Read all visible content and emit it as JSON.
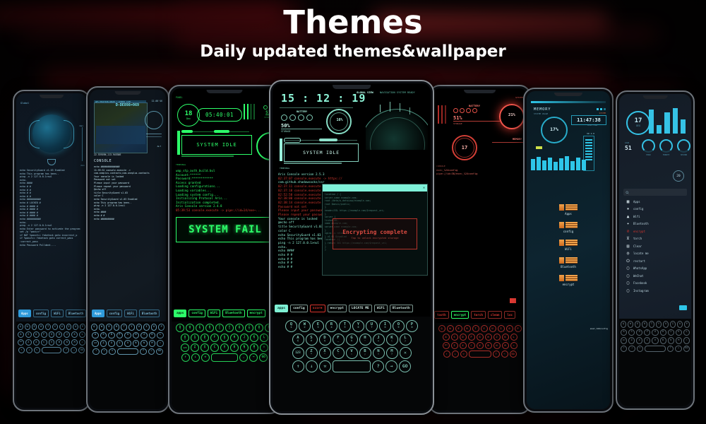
{
  "header": {
    "title": "Themes",
    "subtitle": "Daily updated themes&wallpaper"
  },
  "colors": {
    "accent_teal": "#7ff5d8",
    "accent_green": "#2dff6a",
    "accent_red": "#ff3a36",
    "accent_blue": "#3aa8e0",
    "accent_cyan": "#2ec6e8",
    "bezel": "#6d737a",
    "background": "#050203"
  },
  "phones": [
    {
      "id": "phone-blue-globe",
      "theme": "blue",
      "status_label": "Global",
      "meter_label": "Signal",
      "meter_min": "min",
      "meter_max": "max",
      "console_lines": [
        "echo SecurityGuard v1.03 Enabled",
        "echo This program has been..",
        "ping -n 2 127.0.0.1>nul",
        "echo.",
        "echo  ####",
        "echo #    #",
        "echo #    #",
        "echo #    #",
        "echo #    #",
        "echo ##########",
        "echo # LOCKED #",
        "echo # #### #",
        "echo # #### #",
        "echo # #### #",
        "echo # #### #",
        "echo ##########",
        "echo.",
        "ping -n 2 127.0.0.1>nul",
        "echo Enter password to activate the program",
        "set /p \"pass=>\"",
        "if NOT %pass%==  faketack goto incorrect_p",
        "if %pass%== faketack goto correct_pass",
        "",
        ":correct_pass",
        "",
        "echo Password Pslldmnt...."
      ],
      "tabs": [
        "Apps",
        "config",
        "WiFi",
        "Bluetooth"
      ],
      "active_tab": "Apps"
    },
    {
      "id": "phone-map-console",
      "theme": "blue-map",
      "map_header": "GPS POSITION READY / COORDS LIVE",
      "map_id": "D-DE898=969",
      "map_coords": "22.53919N,113.94530E",
      "time_value": "12.00'46",
      "meter_label": "ALT",
      "console_title": "CONSOLE",
      "console_lines": [
        "echo ##############",
        "11:59:32 console.execute ->",
        "com.oneplus.contacts;com.oneplus.contacts",
        "Your console is locked",
        "Password not set",
        "Please input your password",
        "Please repeat your password",
        "@echo off",
        "title SecurityGuard v1.03",
        "color C",
        "echo SecurityGuard v1.03 Enabled",
        "echo This program has been..",
        "ping -n 2 127.0.0.1>nul",
        "echo.",
        "echo  ####",
        "echo #    #",
        "echo ##########"
      ],
      "tabs": [
        "Apps",
        "config",
        "WiFi",
        "Bluetooth"
      ],
      "active_tab": "Apps"
    },
    {
      "id": "phone-green-terminal",
      "theme": "green",
      "panel_label": "PANEL",
      "date_day": "18",
      "date_month": "Dec",
      "clock": "05:40:01",
      "storage_percent": "51%",
      "storage_label": "STORAGE",
      "status_text": "SYSTEM IDLE",
      "battery_percent": "13",
      "terminal_label": "TERMINAL",
      "console_lines": [
        "wap_stp_auth_build.bul",
        "Account:******",
        "Password:************",
        "Access granted",
        "Loading configurations...",
        "Loading variables...",
        "Loading system config...",
        "Initializing Protocol Aris...",
        "Initialization completed.",
        "Aris Console version 2.4.8",
        "05:39:53 console.execute -> pipe://id=14/exe~..."
      ],
      "banner": "SYSTEM FAIL",
      "tabs": [
        "apps",
        "config",
        "WiFi",
        "Bluetooth",
        "encrypt"
      ],
      "active_tab": "apps",
      "keyboard_rows": [
        [
          "Q 1",
          "W 2",
          "E 3",
          "R 4",
          "T 5",
          "Y 6",
          "U 7",
          "I 8",
          "O 9",
          "P 0"
        ],
        [
          "A @",
          "S #",
          "D $",
          "F _",
          "G &",
          "H -",
          "J +",
          "K (",
          "L )"
        ],
        [
          "123",
          "Z *",
          "X \"",
          "C '",
          "V :",
          "B ;",
          "N !",
          "M ?",
          "✕"
        ],
        [
          "↑",
          "↓",
          "⚒",
          "space",
          ", .",
          "→",
          "GO"
        ]
      ]
    },
    {
      "id": "phone-center-aris",
      "theme": "teal",
      "clock": "15 : 12 : 19",
      "view_label": "GLOBAL VIEW",
      "nav_status": "NAVIGATION SYSTEM READY",
      "battery_label": "BATTERY",
      "battery_percent": "16%",
      "storage_percent": "50%",
      "storage_label": "STORAGE",
      "status_text": "SYSTEM IDLE",
      "terminal_label": "TERMINAL",
      "console_lines": [
        "Aris Console version 2.5.3",
        "02:37:07 console.execute -> https://",
        "com.github.shadowsocks/ssr",
        "02:37:11 console.execute -> pipe://",
        "02:37:18 console.execute -> pipe://",
        "02:52:58 console.execute -> pipe://",
        "02:38:00 console.execute -> pipe://",
        "02:38:14 console.execute -> pipe://",
        "Password not set",
        "Please input your password",
        "Please repeat your password",
        "Your console is locked",
        "@echo off",
        "title SecurityGuard v1.03",
        "color C",
        "echo SecurityGuard v1.03 Enabled",
        "echo This program has been..",
        "ping -n 2 127.0.0.1>nul",
        "echo.",
        "echo      ####",
        "echo    #      #",
        "echo   #        #",
        "echo   #        #",
        "echo   #        #"
      ],
      "overlay": {
        "code_lines": [
          "location / {",
          "  server_name example.com;",
          "  root /data/w_data/www/example.com;",
          "  root $basic/public;",
          "}",
          "  header/SSL https://example.com/$request_uri;",
          "}",
          "server {",
          "  listen 80;",
          "  name example.com;",
          "  server_name example.com;",
          "}",
          "",
          "nginx -s reload",
          "} v1.01 Disabled",
          "location /{ ...",
          "} return 301 https://example.com/$request_uri;",
          "}",
          "}"
        ],
        "dialog_title": "Encrypting complete",
        "dialog_sub": "Tap to unlock encrypted storage"
      },
      "tabs": [
        "apps",
        "config",
        "score",
        "encrypt",
        "LOCATE ME",
        "WiFi",
        "Bluetooth"
      ],
      "active_tab": "apps",
      "danger_tab": "score",
      "keyboard_rows": [
        [
          "Q 1",
          "W 2",
          "E 3",
          "R 4",
          "T 5",
          "Y 6",
          "U 7",
          "I 8",
          "O 9",
          "P 0"
        ],
        [
          "A @",
          "S #",
          "D $",
          "F _",
          "G &",
          "H -",
          "J +",
          "K (",
          "L )"
        ],
        [
          "123",
          "Z *",
          "X \"",
          "C '",
          "V :",
          "B ;",
          "N !",
          "M ?",
          "✕"
        ],
        [
          "↑",
          "↓",
          "⚒",
          "space",
          "?",
          "→",
          "GO"
        ]
      ]
    },
    {
      "id": "phone-red-hud",
      "theme": "red",
      "system_label": "SYSTEM",
      "battery_label": "BATTERY",
      "battery_percent": "21%",
      "storage_percent": "51%",
      "storage_label": "STORAGE",
      "memory_label": "MEMORY",
      "memory_value": "17",
      "console_label": "CONSOLE",
      "console_lines": [
        "exe=_%24config",
        "pipe://id=38/exe=_%24config"
      ],
      "tabs": [
        "tooth",
        "encrypt",
        "torch",
        "clean",
        "loc"
      ],
      "active_tab": "encrypt",
      "keyboard_rows": [
        [
          "Q",
          "W",
          "E",
          "R",
          "T",
          "Y",
          "U",
          "I",
          "O",
          "P"
        ],
        [
          "A",
          "S",
          "D",
          "F",
          "G",
          "H",
          "J",
          "K",
          "L"
        ],
        [
          "123",
          "Z",
          "X",
          "C",
          "V",
          "B",
          "N",
          "M",
          "✕"
        ],
        [
          "↑",
          "↓",
          "⚒",
          "space",
          "?",
          "→",
          "GO"
        ]
      ]
    },
    {
      "id": "phone-cyan-memory",
      "theme": "cyan",
      "memory_label": "MEMORY",
      "memory_sub": "SYSTEM USAGE",
      "memory_percent": "17%",
      "clock_label": "SYSTEM",
      "clock": "11:47:38",
      "clock_sub": "local time",
      "eq_label": "AUDIO",
      "slider_label": "XD 2.0",
      "folders": [
        "Apps",
        "config",
        "WiFi",
        "Bluetooth",
        "encrypt"
      ],
      "file_tag": "exe=_%24config"
    },
    {
      "id": "phone-dial-launcher",
      "theme": "steel-cyan",
      "temp_value": "17",
      "temp_unit": "DEG",
      "secondary_value": "51",
      "secondary_label": "LOAD",
      "dials": [
        {
          "label": "HOUR"
        },
        {
          "label": "MINUTE"
        },
        {
          "label": "SECOND"
        }
      ],
      "badge": "20",
      "search_placeholder": "Search apps",
      "apps": [
        {
          "icon": "grid-icon",
          "label": "Apps"
        },
        {
          "icon": "gear-icon",
          "label": "config"
        },
        {
          "icon": "wifi-icon",
          "label": "Wifi"
        },
        {
          "icon": "bluetooth-icon",
          "label": "Bluetooth"
        },
        {
          "icon": "lock-icon",
          "label": "encrypt"
        },
        {
          "icon": "torch-icon",
          "label": "torch"
        },
        {
          "icon": "trash-icon",
          "label": "Clear"
        },
        {
          "icon": "location-icon",
          "label": "locate me"
        },
        {
          "icon": "power-icon",
          "label": "restart"
        },
        {
          "icon": "app-icon",
          "label": "WhatsApp"
        },
        {
          "icon": "app-icon",
          "label": "WeChat"
        },
        {
          "icon": "app-icon",
          "label": "Facebook"
        },
        {
          "icon": "app-icon",
          "label": "Instagram"
        }
      ],
      "keyboard_rows": [
        [
          "Q",
          "W",
          "E",
          "R",
          "T",
          "Y",
          "U",
          "I",
          "O",
          "P"
        ],
        [
          "A",
          "S",
          "D",
          "F",
          "G",
          "H",
          "J",
          "K",
          "L"
        ],
        [
          "123",
          "Z",
          "X",
          "C",
          "V",
          "B",
          "N",
          "M",
          "✕"
        ],
        [
          "↑",
          "↓",
          "⚒",
          "space",
          "?",
          "→",
          "GO"
        ]
      ]
    }
  ]
}
